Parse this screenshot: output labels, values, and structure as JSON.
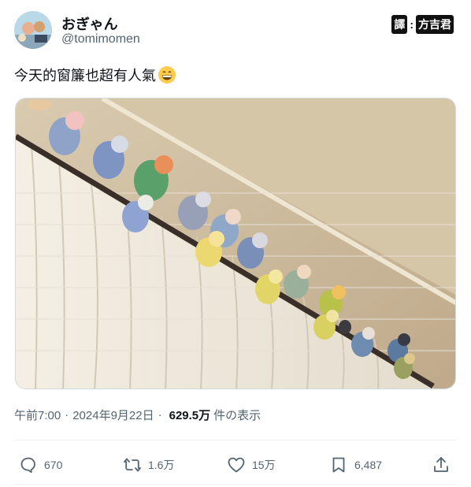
{
  "author": {
    "display_name": "おぎゃん",
    "handle": "@tomimomen",
    "avatar_icon": "user-avatar-icon"
  },
  "watermark": {
    "translate_char": "譯",
    "separator": ":",
    "translator_name": "方吉君"
  },
  "tweet": {
    "text": "今天的窗簾也超有人氣",
    "emoji_icon": "grinning-face-emoji-icon"
  },
  "media": {
    "image_icon": "photo-lovebirds-on-curtain-rod"
  },
  "meta": {
    "time": "午前7:00",
    "separator1": "·",
    "date": "2024年9月22日",
    "separator2": "·",
    "views_count": "629.5万",
    "views_label": "件の表示"
  },
  "actions": {
    "reply": {
      "icon": "reply-icon",
      "count": "670"
    },
    "retweet": {
      "icon": "retweet-icon",
      "count": "1.6万"
    },
    "like": {
      "icon": "heart-icon",
      "count": "15万"
    },
    "bookmark": {
      "icon": "bookmark-icon",
      "count": "6,487"
    },
    "share": {
      "icon": "share-icon"
    }
  },
  "colors": {
    "text_primary": "#0f1419",
    "text_secondary": "#536471",
    "divider": "#eff3f4"
  }
}
